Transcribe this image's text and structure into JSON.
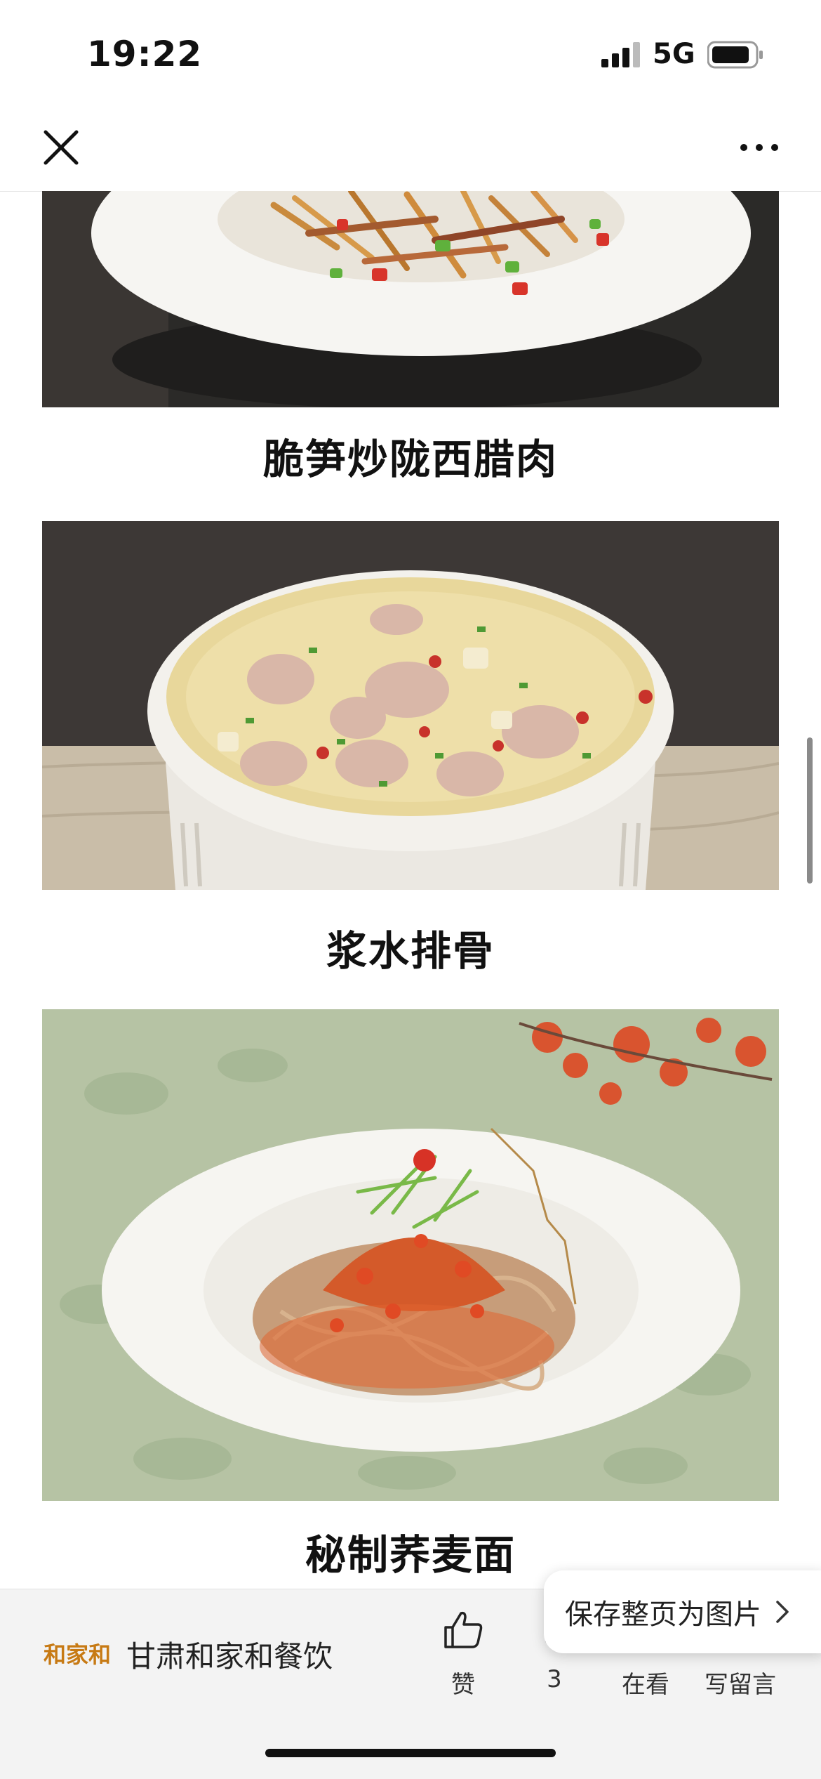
{
  "status_bar": {
    "time": "19:22",
    "network": "5G"
  },
  "nav": {
    "close_icon": "close-icon",
    "more_icon": "more-icon"
  },
  "dishes": [
    {
      "title": "脆笋炒陇西腊肉"
    },
    {
      "title": "浆水排骨"
    },
    {
      "title": "秘制荞麦面"
    }
  ],
  "bottom_bar": {
    "brand_logo": "和家和",
    "brand_name": "甘肃和家和餐饮",
    "like_label": "赞",
    "share_count": "3",
    "wow_label": "在看",
    "comment_label": "写留言"
  },
  "save_popup": {
    "label": "保存整页为图片"
  }
}
